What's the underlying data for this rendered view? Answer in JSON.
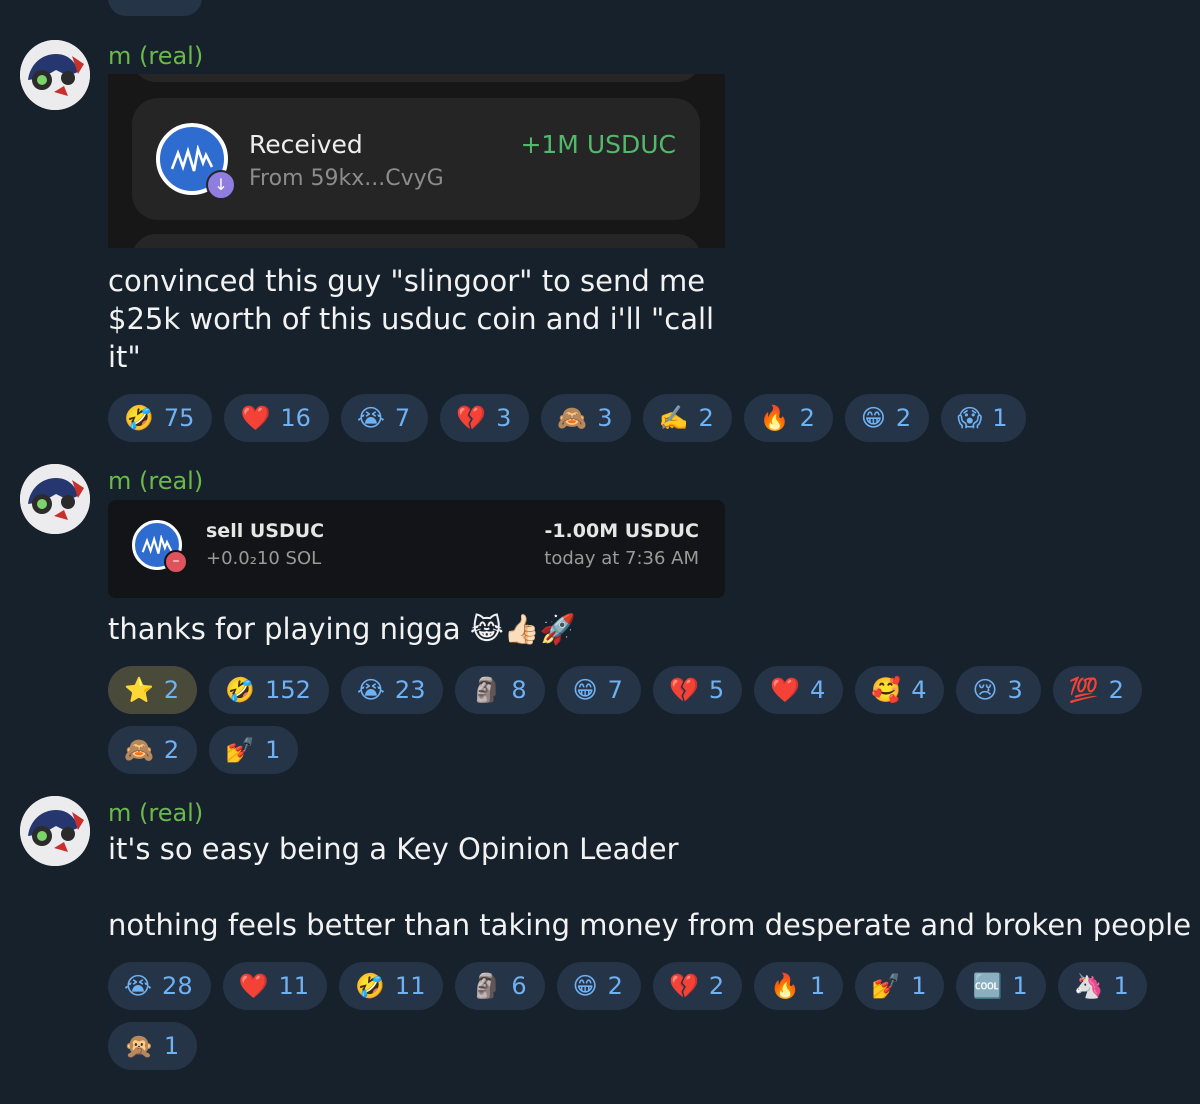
{
  "messages": [
    {
      "sender": "m (real)",
      "receipt": {
        "title": "Received",
        "from": "From 59kx...CvyG",
        "amount": "+1M USDUC"
      },
      "text": [
        "convinced this guy \"slingoor\" to send me",
        "$25k worth of this usduc coin and i'll \"call",
        "it\""
      ],
      "reactions": [
        {
          "emoji": "🤣",
          "count": "75"
        },
        {
          "emoji": "❤️",
          "count": "16"
        },
        {
          "emoji": "😭",
          "count": "7"
        },
        {
          "emoji": "💔",
          "count": "3"
        },
        {
          "emoji": "🙈",
          "count": "3"
        },
        {
          "emoji": "✍️",
          "count": "2"
        },
        {
          "emoji": "🔥",
          "count": "2"
        },
        {
          "emoji": "😁",
          "count": "2"
        },
        {
          "emoji": "😱",
          "count": "1"
        }
      ]
    },
    {
      "sender": "m (real)",
      "trade": {
        "title": "sell USDUC",
        "sub": "+0.0₂10 SOL",
        "amount": "-1.00M USDUC",
        "time": "today at 7:36 AM"
      },
      "text": [
        "thanks for playing nigga 😹👍🏻🚀"
      ],
      "reactions": [
        {
          "emoji": "⭐",
          "count": "2",
          "special": true
        },
        {
          "emoji": "🤣",
          "count": "152"
        },
        {
          "emoji": "😭",
          "count": "23"
        },
        {
          "emoji": "🗿",
          "count": "8"
        },
        {
          "emoji": "😁",
          "count": "7"
        },
        {
          "emoji": "💔",
          "count": "5"
        },
        {
          "emoji": "❤️",
          "count": "4"
        },
        {
          "emoji": "🥰",
          "count": "4"
        },
        {
          "emoji": "😢",
          "count": "3"
        },
        {
          "emoji": "💯",
          "count": "2"
        },
        {
          "emoji": "🙈",
          "count": "2"
        },
        {
          "emoji": "💅",
          "count": "1"
        }
      ]
    },
    {
      "sender": "m (real)",
      "text": [
        "it's so easy being a Key Opinion Leader",
        "",
        "nothing feels better than taking money from desperate and broken people"
      ],
      "reactions": [
        {
          "emoji": "😭",
          "count": "28"
        },
        {
          "emoji": "❤️",
          "count": "11"
        },
        {
          "emoji": "🤣",
          "count": "11"
        },
        {
          "emoji": "🗿",
          "count": "6"
        },
        {
          "emoji": "😁",
          "count": "2"
        },
        {
          "emoji": "💔",
          "count": "2"
        },
        {
          "emoji": "🔥",
          "count": "1"
        },
        {
          "emoji": "💅",
          "count": "1"
        },
        {
          "emoji": "🆒",
          "count": "1"
        },
        {
          "emoji": "🦄",
          "count": "1"
        },
        {
          "emoji": "🙊",
          "count": "1"
        }
      ]
    }
  ]
}
